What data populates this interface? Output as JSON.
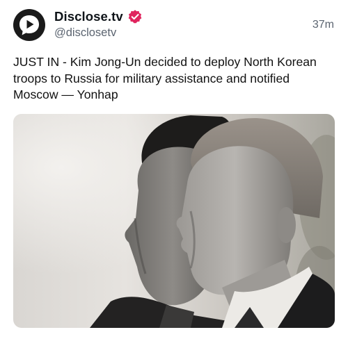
{
  "post": {
    "author": {
      "display_name": "Disclose.tv",
      "handle": "@disclosetv",
      "avatar_icon": "play-speech-bubble-icon",
      "verified_badge_icon": "verified-check-icon",
      "verified_color": "#e0245e"
    },
    "timestamp": "37m",
    "text": "JUST IN - Kim Jong-Un decided to deploy North Korean troops to Russia for military assistance and notified Moscow — Yonhap",
    "media": {
      "type": "photo",
      "alt_icon": "photo-two-leaders-icon"
    }
  }
}
